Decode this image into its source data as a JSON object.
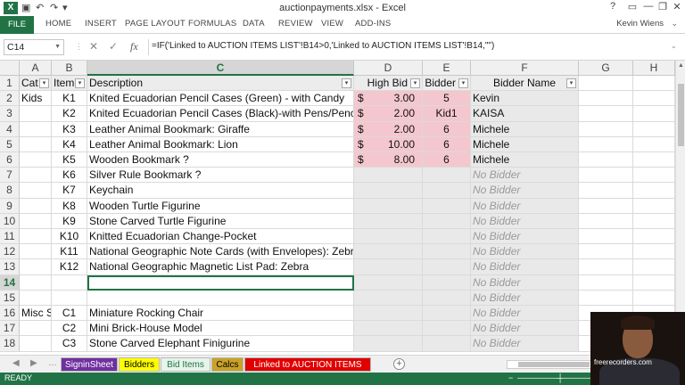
{
  "titlebar": {
    "logo": "X",
    "title": "auctionpayments.xlsx - Excel",
    "undo": "↶",
    "redo": "↷",
    "help": "?",
    "minimize": "—",
    "restore": "❐",
    "close": "✕"
  },
  "ribbon": {
    "file": "FILE",
    "tabs": [
      "HOME",
      "INSERT",
      "PAGE LAYOUT",
      "FORMULAS",
      "DATA",
      "REVIEW",
      "VIEW",
      "ADD-INS"
    ],
    "user": "Kevin Wiens"
  },
  "formula_bar": {
    "name_box": "C14",
    "cancel": "✕",
    "enter": "✓",
    "fx": "fx",
    "formula": "=IF('Linked to AUCTION ITEMS LIST'!B14>0,'Linked to AUCTION ITEMS LIST'!B14,\"\")"
  },
  "columns": [
    "A",
    "B",
    "C",
    "D",
    "E",
    "F",
    "G",
    "H"
  ],
  "headers": {
    "a": "Cat",
    "b": "Item",
    "c": "Description",
    "d": "High Bid",
    "e": "Bidder",
    "f": "Bidder Name"
  },
  "rows": [
    {
      "num": "1"
    },
    {
      "num": "2",
      "a": "Kids",
      "b": "K1",
      "c": "Knited Ecuadorian Pencil Cases (Green) - with Candy",
      "d_cur": "$",
      "d": "3.00",
      "e": "5",
      "f": "Kevin"
    },
    {
      "num": "3",
      "a": "",
      "b": "K2",
      "c": "Knited Ecuadorian Pencil Cases (Black)-with Pens/Pencils",
      "d_cur": "$",
      "d": "2.00",
      "e": "Kid1",
      "f": "KAISA"
    },
    {
      "num": "4",
      "a": "",
      "b": "K3",
      "c": "Leather Animal Bookmark: Giraffe",
      "d_cur": "$",
      "d": "2.00",
      "e": "6",
      "f": "Michele"
    },
    {
      "num": "5",
      "a": "",
      "b": "K4",
      "c": "Leather Animal Bookmark: Lion",
      "d_cur": "$",
      "d": "10.00",
      "e": "6",
      "f": "Michele"
    },
    {
      "num": "6",
      "a": "",
      "b": "K5",
      "c": "Wooden Bookmark  ?",
      "d_cur": "$",
      "d": "8.00",
      "e": "6",
      "f": "Michele"
    },
    {
      "num": "7",
      "a": "",
      "b": "K6",
      "c": "Silver Rule Bookmark  ?",
      "f": "No Bidder"
    },
    {
      "num": "8",
      "a": "",
      "b": "K7",
      "c": "Keychain",
      "f": "No Bidder"
    },
    {
      "num": "9",
      "a": "",
      "b": "K8",
      "c": "Wooden Turtle Figurine",
      "f": "No Bidder"
    },
    {
      "num": "10",
      "a": "",
      "b": "K9",
      "c": "Stone Carved Turtle Figurine",
      "f": "No Bidder"
    },
    {
      "num": "11",
      "a": "",
      "b": "K10",
      "c": "Knitted Ecuadorian Change-Pocket",
      "f": "No Bidder"
    },
    {
      "num": "12",
      "a": "",
      "b": "K11",
      "c": "National Geographic Note Cards (with Envelopes): Zebra",
      "f": "No Bidder"
    },
    {
      "num": "13",
      "a": "",
      "b": "K12",
      "c": "National Geographic Magnetic List Pad: Zebra",
      "f": "No Bidder"
    },
    {
      "num": "14",
      "a": "",
      "b": "",
      "c": "",
      "f": "No Bidder"
    },
    {
      "num": "15",
      "a": "",
      "b": "",
      "c": "",
      "f": "No Bidder"
    },
    {
      "num": "16",
      "a": "Misc S",
      "b": "C1",
      "c": "Miniature Rocking Chair",
      "f": "No Bidder"
    },
    {
      "num": "17",
      "a": "",
      "b": "C2",
      "c": "Mini Brick-House Model",
      "f": "No Bidder"
    },
    {
      "num": "18",
      "a": "",
      "b": "C3",
      "c": "Stone Carved Elephant Finigurine",
      "f": "No Bidder"
    }
  ],
  "sheet_tabs": [
    {
      "label": "SigninSheet",
      "color": "#7030a0",
      "text": "#ffffff"
    },
    {
      "label": "Bidders",
      "color": "#ffff00",
      "text": "#000000"
    },
    {
      "label": "Bid Items",
      "color": "#e6f4ea",
      "text": "#217346"
    },
    {
      "label": "Calcs",
      "color": "#c9a227",
      "text": "#000000"
    },
    {
      "label": "Linked to AUCTION ITEMS LIST",
      "color": "#e00000",
      "text": "#ffffff"
    }
  ],
  "status": {
    "ready": "READY",
    "zoom_minus": "−",
    "zoom_plus": "+"
  },
  "webcam": {
    "watermark": "freerecorders.com"
  },
  "colors": {
    "excel_green": "#217346",
    "highlight_pink": "#f4c7ce"
  }
}
